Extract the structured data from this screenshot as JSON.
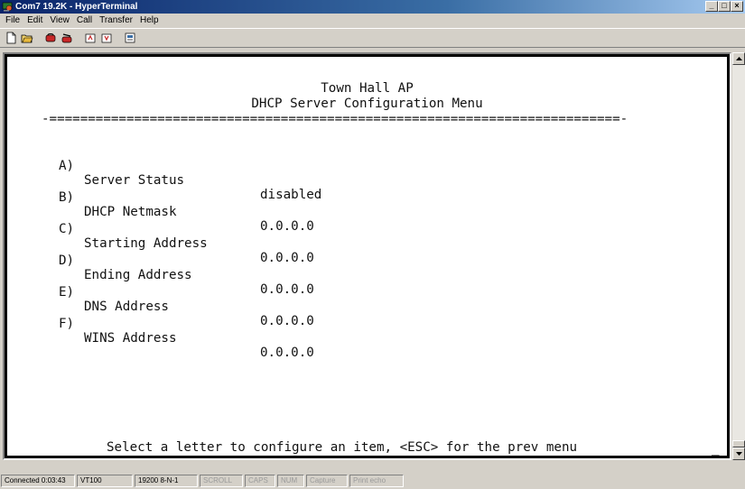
{
  "window": {
    "title": "Com7 19.2K - HyperTerminal",
    "controls": {
      "minimize": "_",
      "maximize": "□",
      "close": "×"
    }
  },
  "menu": [
    "File",
    "Edit",
    "View",
    "Call",
    "Transfer",
    "Help"
  ],
  "toolbar": {
    "buttons": [
      "new-icon",
      "open-icon",
      "connect-icon",
      "disconnect-icon",
      "send-icon",
      "receive-icon",
      "properties-icon"
    ]
  },
  "terminal": {
    "header_line1": "Town Hall AP",
    "header_line2": "DHCP Server Configuration Menu",
    "separator": "-==========================================================================-",
    "items": [
      {
        "key": "A)",
        "label": "Server Status",
        "value": "disabled"
      },
      {
        "key": "B)",
        "label": "DHCP Netmask",
        "value": "0.0.0.0"
      },
      {
        "key": "C)",
        "label": "Starting Address",
        "value": "0.0.0.0"
      },
      {
        "key": "D)",
        "label": "Ending Address",
        "value": "0.0.0.0"
      },
      {
        "key": "E)",
        "label": "DNS Address",
        "value": "0.0.0.0"
      },
      {
        "key": "F)",
        "label": "WINS Address",
        "value": "0.0.0.0"
      }
    ],
    "prompt": "Select a letter to configure an item, <ESC> for the prev menu",
    "cursor": "_"
  },
  "statusbar": {
    "connected": "Connected 0:03:43",
    "emulation": "VT100",
    "port_settings": "19200 8-N-1",
    "scroll": "SCROLL",
    "caps": "CAPS",
    "num": "NUM",
    "capture": "Capture",
    "print_echo": "Print echo"
  },
  "colors": {
    "titlebar_start": "#0a246a",
    "titlebar_end": "#a6caf0",
    "chrome": "#d4d0c8",
    "terminal_bg": "#ffffff",
    "terminal_text": "#111111"
  }
}
